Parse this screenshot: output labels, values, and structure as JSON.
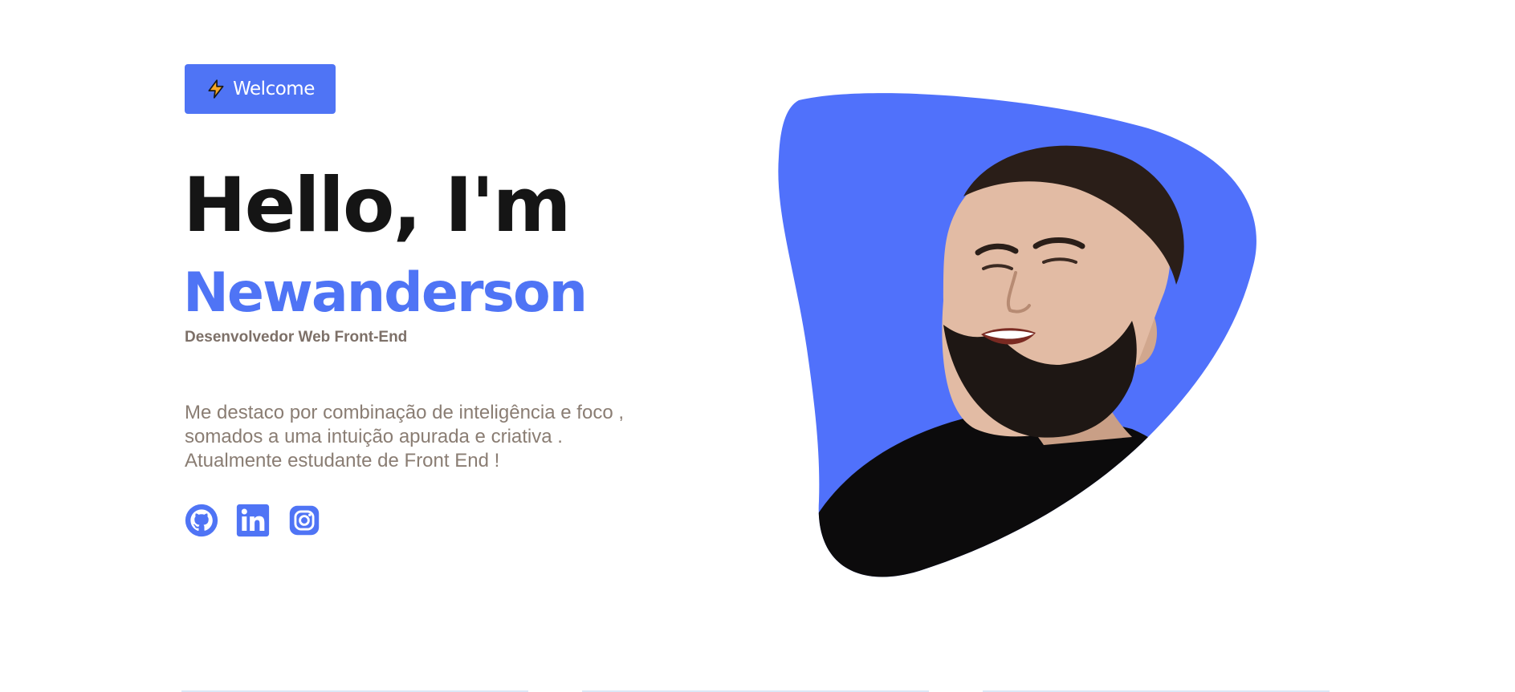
{
  "hero": {
    "welcome_label": "Welcome",
    "headline": "Hello, I'm",
    "name": "Newanderson",
    "role": "Desenvolvedor Web Front-End",
    "bio_lines": [
      "Me destaco por combinação de inteligência e foco ,",
      "somados a uma intuição apurada e criativa .",
      "Atualmente estudante de Front End !"
    ]
  },
  "socials": [
    {
      "name": "github",
      "icon": "github-icon"
    },
    {
      "name": "linkedin",
      "icon": "linkedin-icon"
    },
    {
      "name": "instagram",
      "icon": "instagram-icon"
    }
  ],
  "colors": {
    "accent": "#4f74f5",
    "heading": "#151515",
    "muted": "#8a7d73",
    "role": "#7d7068",
    "bolt": "#f5a623"
  }
}
